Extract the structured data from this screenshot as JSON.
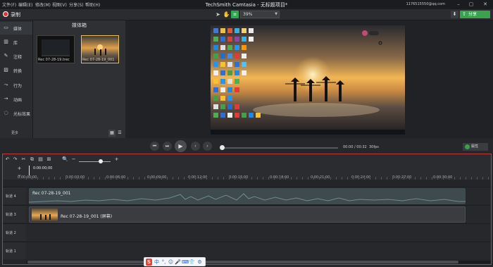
{
  "menu": [
    "文件(F)",
    "编辑(E)",
    "修改(M)",
    "视图(V)",
    "分享(S)",
    "帮助(H)"
  ],
  "app_title": "TechSmith Camtasia - 无标题项目*",
  "account": "1176515550@qq.com",
  "window_controls": [
    "–",
    "▢",
    "✕"
  ],
  "toolbar": {
    "record_label": "录制",
    "zoom_value": "39%",
    "share_label": "分享",
    "share_icon": "⇧"
  },
  "sidebar": {
    "items": [
      {
        "label": "媒体",
        "icon": "▭"
      },
      {
        "label": "库",
        "icon": "▥"
      },
      {
        "label": "注释",
        "icon": "✎"
      },
      {
        "label": "转换",
        "icon": "▨"
      },
      {
        "label": "行为",
        "icon": "⤳"
      },
      {
        "label": "动画",
        "icon": "→"
      },
      {
        "label": "光标效果",
        "icon": "◌"
      }
    ],
    "more_label": "更多",
    "add_label": "+"
  },
  "media_bin": {
    "title": "媒体箱",
    "items": [
      {
        "label": "Rec 07-28-19.trec"
      },
      {
        "label": "Rec 07-28-19_001"
      }
    ]
  },
  "playback": {
    "time": "00:00 / 00:32",
    "fps": "30fps",
    "properties_label": "属性"
  },
  "timeline": {
    "playhead_time": "0:00:00;00",
    "ticks": [
      "0:00:00;00",
      "0:00:03;00",
      "0:00:06;00",
      "0:00:09;00",
      "0:00:12;00",
      "0:00:15;00",
      "0:00:18;00",
      "0:00:21;00",
      "0:00:24;00",
      "0:00:27;00",
      "0:00:30;00"
    ],
    "tracks": [
      {
        "label": "轨道 4",
        "clip": "Rec 07-28-19_001",
        "kind": "audio"
      },
      {
        "label": "轨道 3",
        "clip": "Rec 07-28-19_001 (屏幕)",
        "kind": "video"
      },
      {
        "label": "轨道 2",
        "clip": "",
        "kind": "empty"
      },
      {
        "label": "轨道 1",
        "clip": "",
        "kind": "empty"
      }
    ]
  },
  "ime_bar": [
    "S",
    "中",
    "°,",
    "☺",
    "🎤",
    "⌨",
    "👕",
    "⚙"
  ],
  "colors": {
    "accent_green": "#3aa24c",
    "record_red": "#e03434",
    "timeline_border": "#c23a3a"
  }
}
